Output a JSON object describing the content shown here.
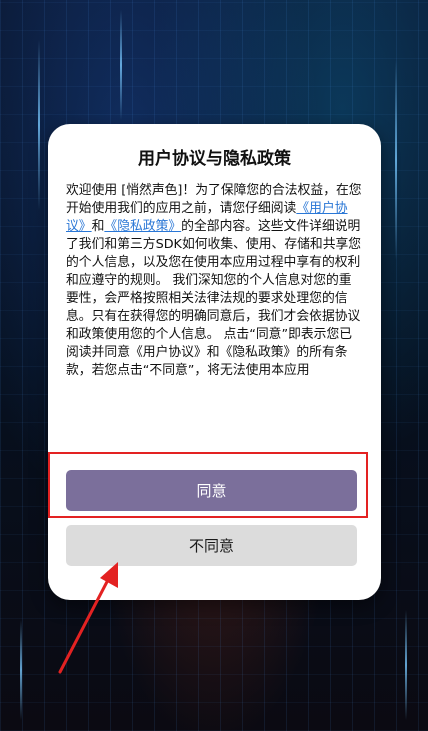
{
  "dialog": {
    "title": "用户协议与隐私政策",
    "body_intro": "欢迎使用 [悄然声色]！为了保障您的合法权益，在您开始使用我们的应用之前，请您仔细阅读",
    "link_user_agreement": "《用户协议》",
    "conjunction": "和",
    "link_privacy_policy": "《隐私政策》",
    "body_rest": "的全部内容。这些文件详细说明了我们和第三方SDK如何收集、使用、存储和共享您的个人信息，以及您在使用本应用过程中享有的权利和应遵守的规则。 我们深知您的个人信息对您的重要性，会严格按照相关法律法规的要求处理您的信息。只有在获得您的明确同意后，我们才会依据协议和政策使用您的个人信息。 点击“同意”即表示您已阅读并同意《用户协议》和《隐私政策》的所有条款，若您点击“不同意”，将无法使用本应用",
    "agree_label": "同意",
    "disagree_label": "不同意"
  },
  "colors": {
    "agree_button": "#7b6f9b",
    "disagree_button": "#dcdcdc",
    "link": "#2a77d6",
    "highlight_box": "#e32222",
    "annotation_arrow": "#e32222"
  },
  "icons": {
    "annotation": "arrow-up-right-icon"
  }
}
